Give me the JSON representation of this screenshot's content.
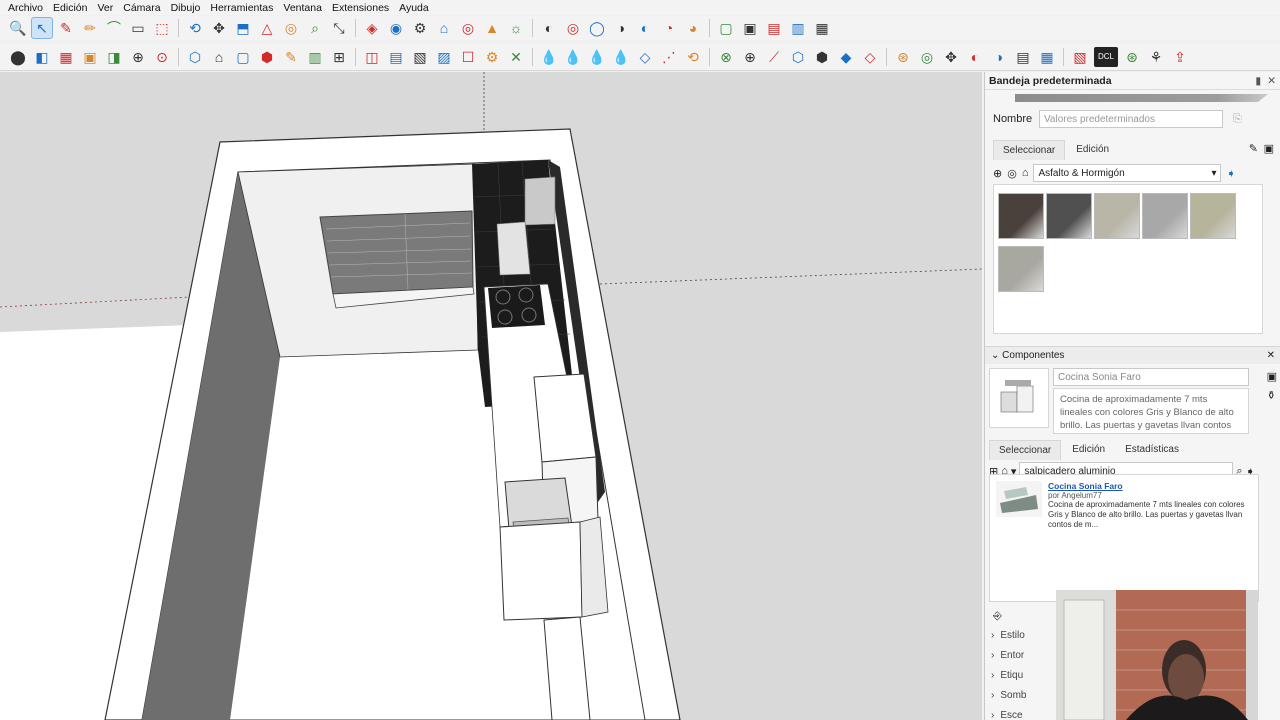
{
  "menu": [
    "Archivo",
    "Edición",
    "Ver",
    "Cámara",
    "Dibujo",
    "Herramientas",
    "Ventana",
    "Extensiones",
    "Ayuda"
  ],
  "toolbar1": [
    "🔍",
    "↖",
    "✎",
    "✏",
    "⌒",
    "▭",
    "⬚",
    "⟲",
    "✥",
    "⬒",
    "△",
    "◎",
    "⌕",
    "⤡",
    "◈",
    "◉",
    "⚙",
    "⌂",
    "◎",
    "▲",
    "☼",
    "◐",
    "◎",
    "◯",
    "◑",
    "◐",
    "◔",
    "◕",
    "▢",
    "▣",
    "▤",
    "▥",
    "▦"
  ],
  "toolbar2": [
    "⬤",
    "◧",
    "▦",
    "▣",
    "◨",
    "⊕",
    "⊙",
    "⬡",
    "⌂",
    "▢",
    "⬢",
    "✎",
    "▥",
    "⊞",
    "◫",
    "▤",
    "▧",
    "▨",
    "☐",
    "⚙",
    "✕",
    "💧",
    "💧",
    "💧",
    "💧",
    "◇",
    "⋰",
    "⟲",
    "⊗",
    "⊕",
    "⟋",
    "⬡",
    "⬢",
    "◆",
    "◇",
    "⊛",
    "◎",
    "✥",
    "◐",
    "◑",
    "▤",
    "▦",
    "▧",
    "DCL",
    "⊛",
    "⚘",
    "⇪"
  ],
  "tray": {
    "title": "Bandeja predeterminada",
    "materials": {
      "name_label": "Nombre",
      "name_placeholder": "Valores predeterminados",
      "tab_select": "Seleccionar",
      "tab_edit": "Edición",
      "collection": "Asfalto & Hormigón",
      "swatch_colors": [
        "#4a403c",
        "#505050",
        "#b9b6a8",
        "#a8a8a8",
        "#b7b49c",
        "#a9a8a0"
      ]
    },
    "components": {
      "header": "Componentes",
      "name": "Cocina Sonia Faro",
      "description": "Cocina de aproximadamente 7 mts lineales con colores Gris y Blanco de alto brillo. Las puertas y gavetas llvan contos",
      "tab_select": "Seleccionar",
      "tab_edit": "Edición",
      "tab_stats": "Estadísticas",
      "search_value": "salpicadero aluminio",
      "result_title": "Cocina Sonia Faro",
      "result_by": "por Angelum77",
      "result_desc": "Cocina de aproximadamente 7 mts lineales con colores Gris y Blanco de alto brillo. Las puertas y gavetas llvan contos de m..."
    },
    "collapsed_sections": [
      "Estilo",
      "Entor",
      "Etiqu",
      "Somb",
      "Esce"
    ]
  }
}
